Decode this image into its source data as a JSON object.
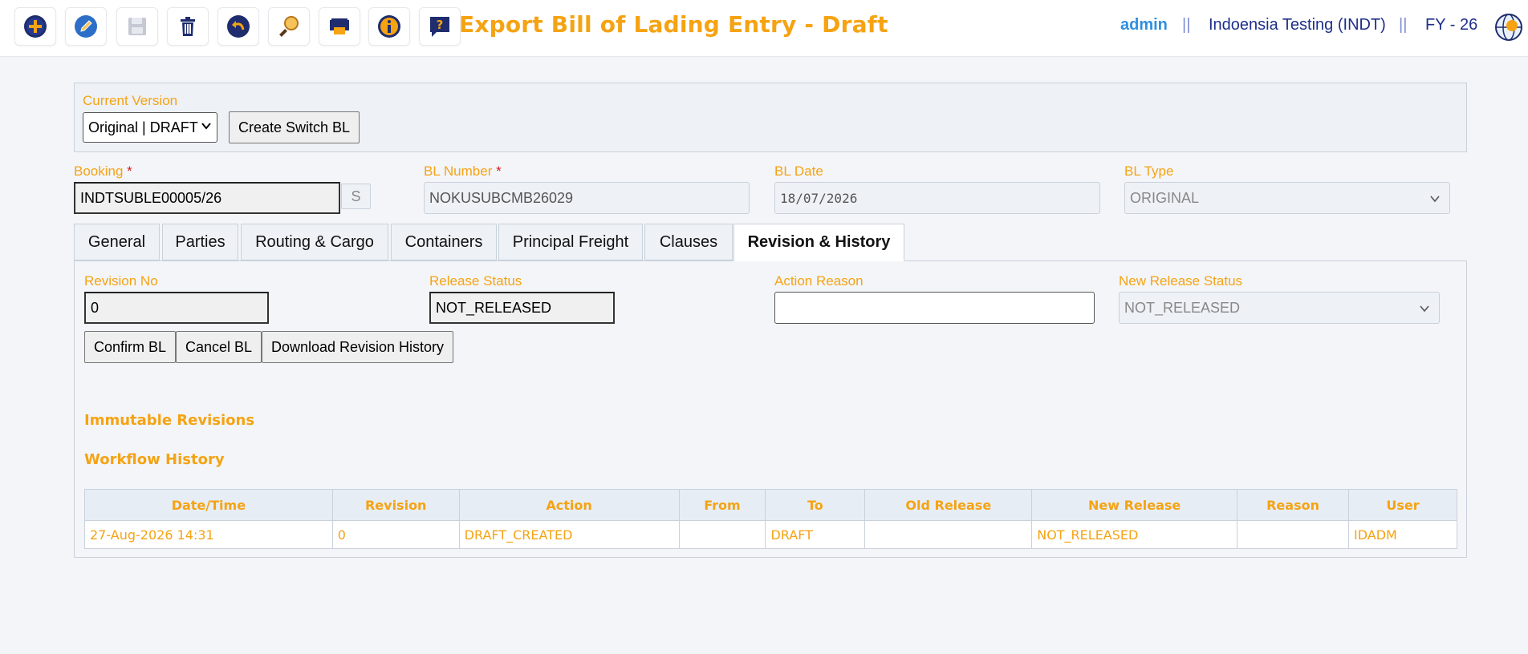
{
  "header": {
    "title": "Export Bill of Lading Entry - Draft",
    "user": "admin",
    "separator": "||",
    "company": "Indoensia Testing (INDT)",
    "fiscal_year": "FY - 26"
  },
  "toolbar": [
    {
      "name": "add-icon"
    },
    {
      "name": "edit-icon"
    },
    {
      "name": "save-icon"
    },
    {
      "name": "delete-icon"
    },
    {
      "name": "undo-icon"
    },
    {
      "name": "search-icon"
    },
    {
      "name": "print-icon"
    },
    {
      "name": "info-icon"
    },
    {
      "name": "help-icon"
    }
  ],
  "version": {
    "label": "Current Version",
    "selected": "Original | DRAFT",
    "create_switch_label": "Create Switch BL"
  },
  "fields": {
    "booking_label": "Booking",
    "booking_value": "INDTSUBLE00005/26",
    "booking_s_button": "S",
    "bl_number_label": "BL Number",
    "bl_number_value": "NOKUSUBCMB26029",
    "bl_date_label": "BL Date",
    "bl_date_value": "18/07/2026",
    "bl_type_label": "BL Type",
    "bl_type_value": "ORIGINAL",
    "required_mark": "*"
  },
  "tabs": [
    {
      "label": "General"
    },
    {
      "label": "Parties"
    },
    {
      "label": "Routing & Cargo"
    },
    {
      "label": "Containers"
    },
    {
      "label": "Principal Freight"
    },
    {
      "label": "Clauses"
    },
    {
      "label": "Revision & History",
      "active": true
    }
  ],
  "revision": {
    "revision_no_label": "Revision No",
    "revision_no_value": "0",
    "release_status_label": "Release Status",
    "release_status_value": "NOT_RELEASED",
    "action_reason_label": "Action Reason",
    "action_reason_value": "",
    "new_release_status_label": "New Release Status",
    "new_release_status_value": "NOT_RELEASED",
    "confirm_label": "Confirm BL",
    "cancel_label": "Cancel BL",
    "download_label": "Download Revision History",
    "immutable_title": "Immutable Revisions",
    "workflow_title": "Workflow History"
  },
  "history": {
    "columns": [
      "Date/Time",
      "Revision",
      "Action",
      "From",
      "To",
      "Old Release",
      "New Release",
      "Reason",
      "User"
    ],
    "rows": [
      [
        "27-Aug-2026 14:31",
        "0",
        "DRAFT_CREATED",
        "",
        "DRAFT",
        "",
        "NOT_RELEASED",
        "",
        "IDADM"
      ]
    ]
  },
  "colors": {
    "accent": "#f5a313",
    "user": "#2f8fe0",
    "navy": "#1e2f8a"
  }
}
